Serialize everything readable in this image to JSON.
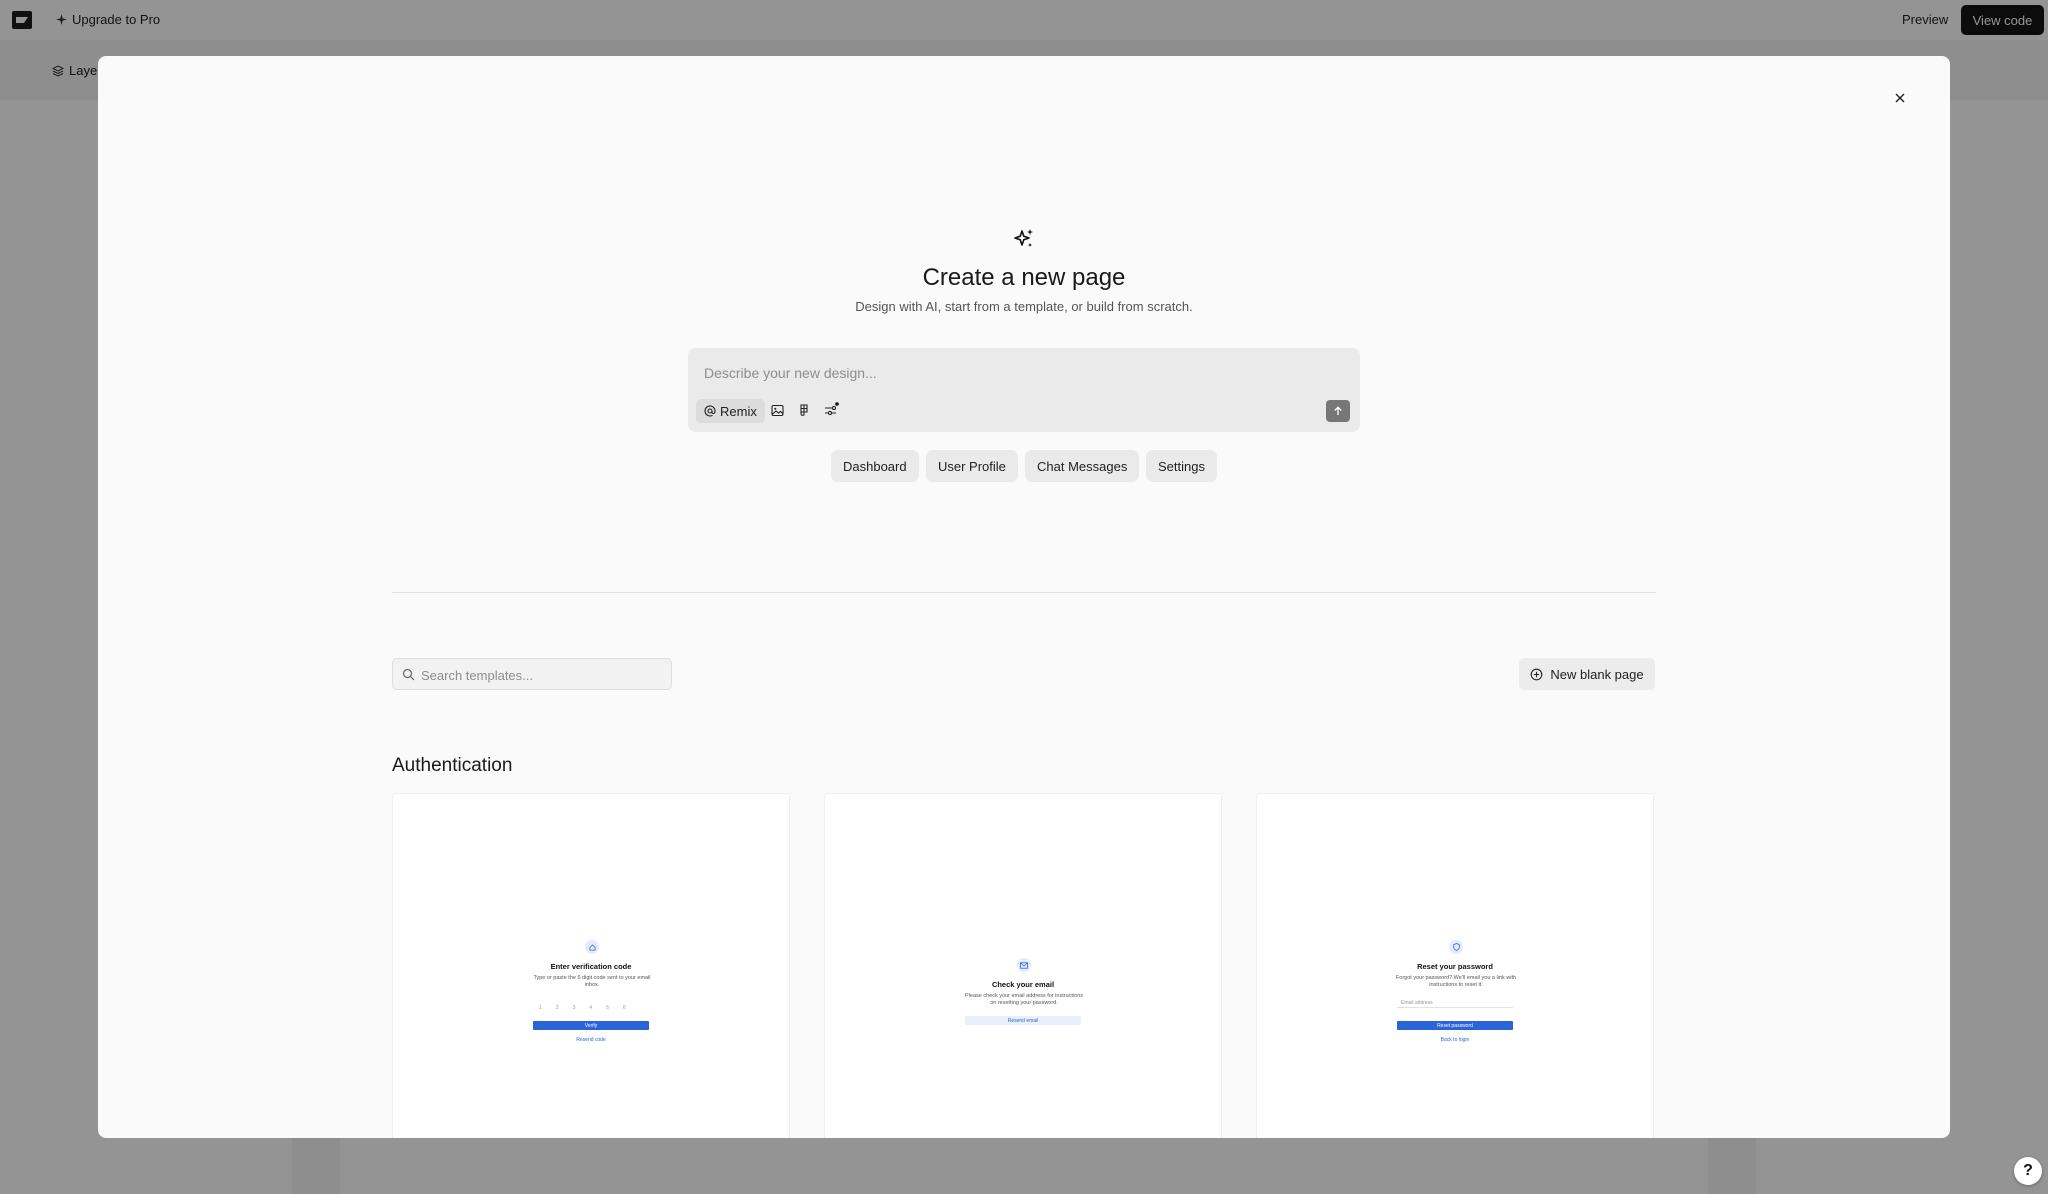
{
  "topbar": {
    "upgrade_label": "Upgrade to Pro",
    "preview_label": "Preview",
    "view_code_label": "View code"
  },
  "subbar": {
    "layers_label": "Layers"
  },
  "help": {
    "label": "?"
  },
  "modal": {
    "title": "Create a new page",
    "subtitle": "Design with AI, start from a template, or build from scratch.",
    "prompt": {
      "placeholder": "Describe your new design...",
      "value": "",
      "remix_label": "Remix"
    },
    "suggestions": [
      "Dashboard",
      "User Profile",
      "Chat Messages",
      "Settings"
    ],
    "search": {
      "placeholder": "Search templates...",
      "value": ""
    },
    "new_blank_label": "New blank page",
    "section_title": "Authentication",
    "templates": [
      {
        "title": "Enter verification code",
        "subtitle": "Type or paste the 6 digit code sent to your email inbox.",
        "digits": [
          "1",
          "2",
          "3",
          "4",
          "5",
          "6"
        ],
        "primary_label": "Verify",
        "link_label": "Resend code"
      },
      {
        "title": "Check your email",
        "subtitle": "Please check your email address for instructions on resetting your password.",
        "secondary_label": "Resend email"
      },
      {
        "title": "Reset your password",
        "subtitle": "Forgot your password? We'll email you a link with instructions to reset it.",
        "field_placeholder": "Email address",
        "primary_label": "Reset password",
        "link_label": "Back to login"
      }
    ]
  },
  "colors": {
    "accent": "#2b63d9",
    "dark_button": "#151515",
    "overlay": "#000000"
  }
}
